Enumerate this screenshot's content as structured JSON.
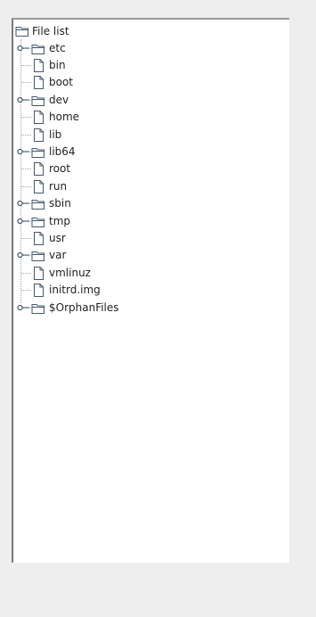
{
  "tree": {
    "root": {
      "label": "File list",
      "icon": "folder-open-icon"
    },
    "items": [
      {
        "label": "etc",
        "type": "folder",
        "expandable": true
      },
      {
        "label": "bin",
        "type": "file",
        "expandable": false
      },
      {
        "label": "boot",
        "type": "file",
        "expandable": false
      },
      {
        "label": "dev",
        "type": "folder",
        "expandable": true
      },
      {
        "label": "home",
        "type": "file",
        "expandable": false
      },
      {
        "label": "lib",
        "type": "file",
        "expandable": false
      },
      {
        "label": "lib64",
        "type": "folder",
        "expandable": true
      },
      {
        "label": "root",
        "type": "file",
        "expandable": false
      },
      {
        "label": "run",
        "type": "file",
        "expandable": false
      },
      {
        "label": "sbin",
        "type": "folder",
        "expandable": true
      },
      {
        "label": "tmp",
        "type": "folder",
        "expandable": true
      },
      {
        "label": "usr",
        "type": "file",
        "expandable": false
      },
      {
        "label": "var",
        "type": "folder",
        "expandable": true
      },
      {
        "label": "vmlinuz",
        "type": "file",
        "expandable": false
      },
      {
        "label": "initrd.img",
        "type": "file",
        "expandable": false
      },
      {
        "label": "$OrphanFiles",
        "type": "folder",
        "expandable": true
      }
    ]
  },
  "colors": {
    "background": "#eeeeee",
    "panel": "#ffffff",
    "icon_stroke": "#44586e",
    "connector": "#9aa6b4"
  }
}
